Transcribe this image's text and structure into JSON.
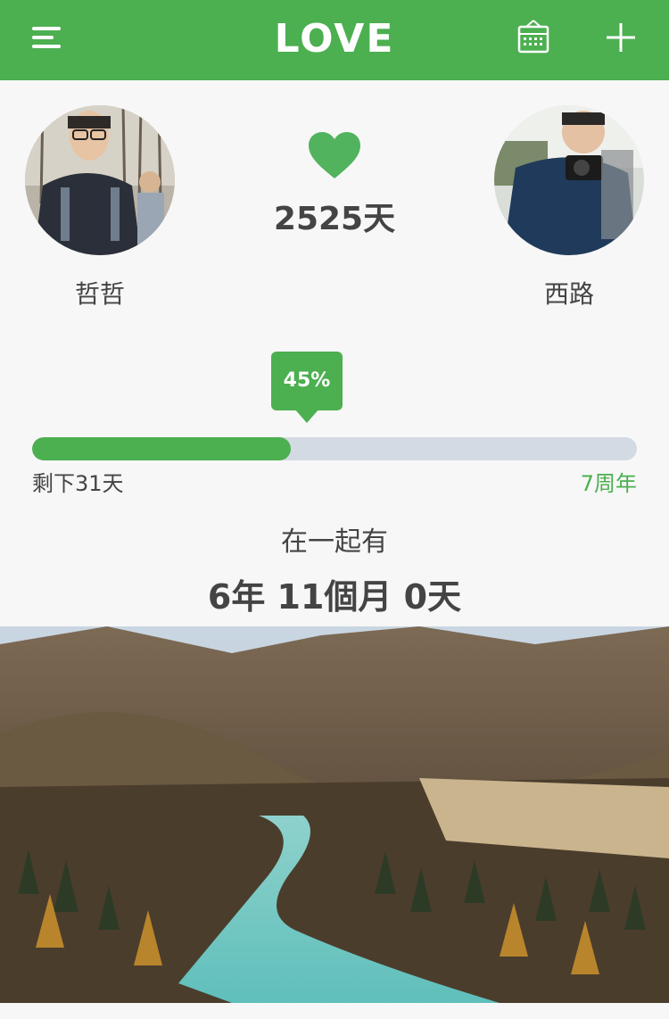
{
  "header": {
    "logo_text": "LOVE",
    "menu_icon": "menu-icon",
    "calendar_icon": "calendar-icon",
    "add_icon": "plus-icon",
    "bar_color": "#4caf50"
  },
  "couple": {
    "left_name": "哲哲",
    "right_name": "西路",
    "days_together": "2525天",
    "heart_icon": "heart-icon"
  },
  "progress": {
    "percent_label": "45%",
    "percent": 45,
    "remaining_label": "剩下31天",
    "milestone_label": "7周年"
  },
  "together": {
    "label": "在一起有",
    "value": "6年 11個月 0天"
  }
}
